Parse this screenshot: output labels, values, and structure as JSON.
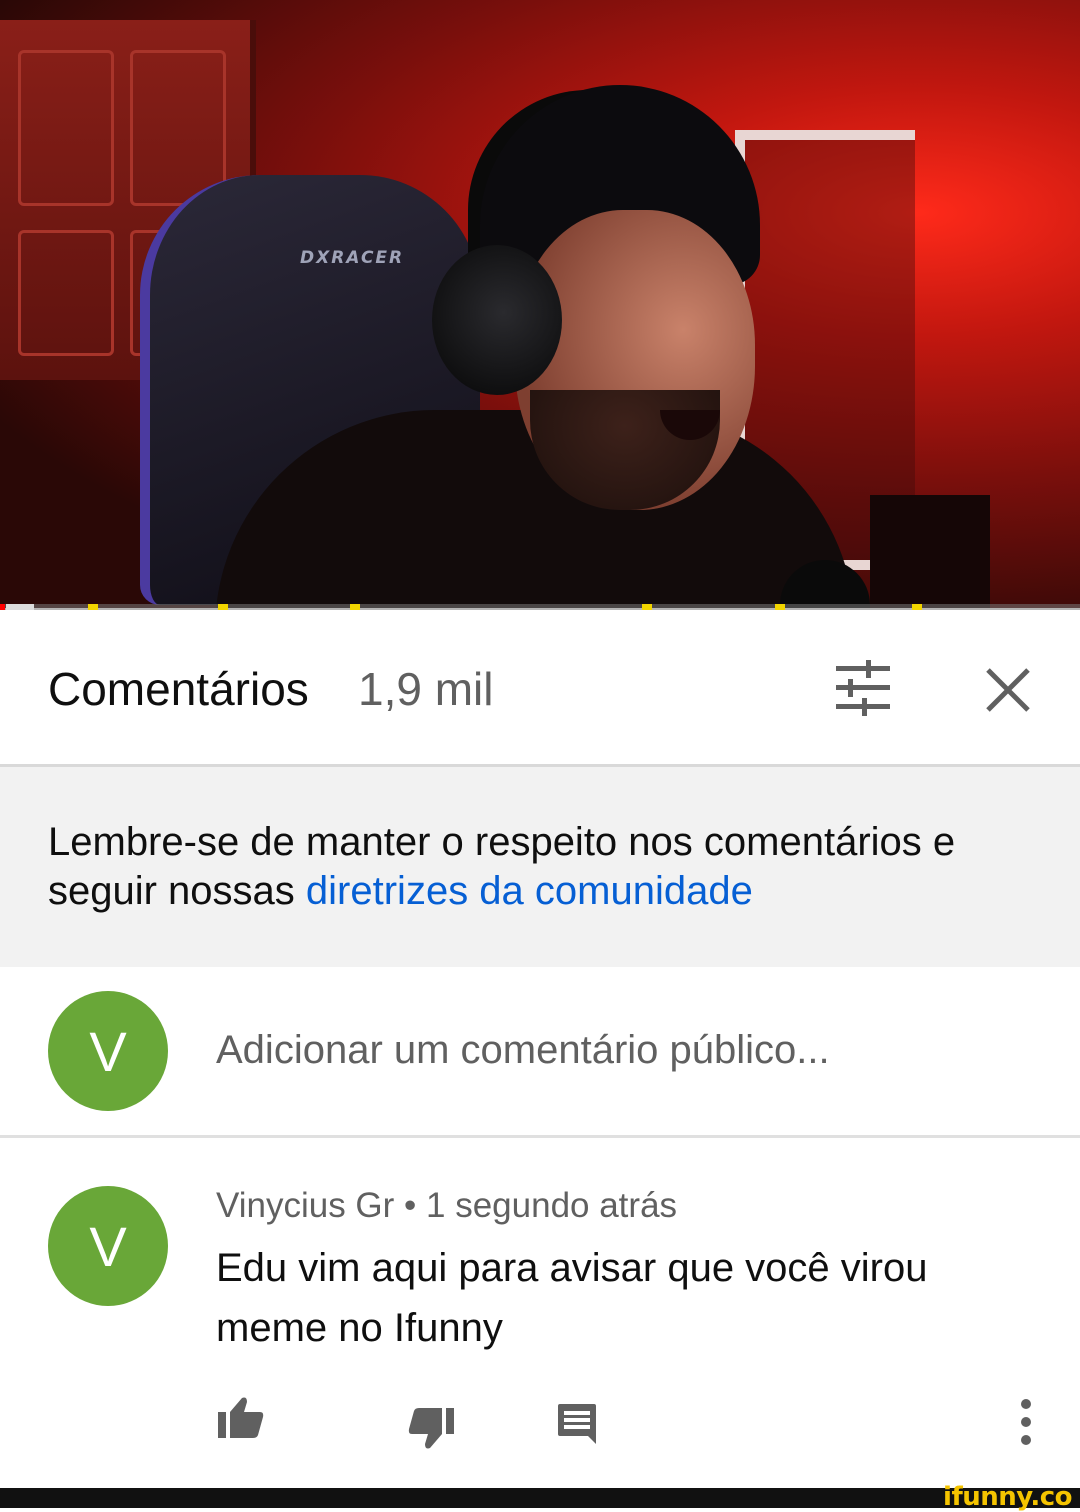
{
  "video": {
    "chair_brand": "DXRACER",
    "progress_fraction": 0.005
  },
  "comments_header": {
    "title": "Comentários",
    "count": "1,9 mil",
    "sort_icon": "sort-filter-icon",
    "close_icon": "close-icon"
  },
  "guideline_banner": {
    "text": "Lembre-se de manter o respeito nos comentários e seguir nossas ",
    "link_text": "diretrizes da comunidade"
  },
  "add_comment": {
    "avatar_letter": "V",
    "placeholder": "Adicionar um comentário público..."
  },
  "comment": {
    "avatar_letter": "V",
    "author": "Vinycius Gr",
    "separator": " • ",
    "time": "1 segundo atrás",
    "text": "Edu vim aqui para avisar que você virou meme no Ifunny",
    "actions": [
      "like-icon",
      "dislike-icon",
      "reply-icon",
      "more-vert-icon"
    ]
  },
  "watermark": "ifunny.co",
  "colors": {
    "avatar": "#69a738",
    "link": "#065fd4",
    "progress": "#ff0000",
    "ad_marker": "#f2d500",
    "banner_bg": "#f2f2f2"
  }
}
